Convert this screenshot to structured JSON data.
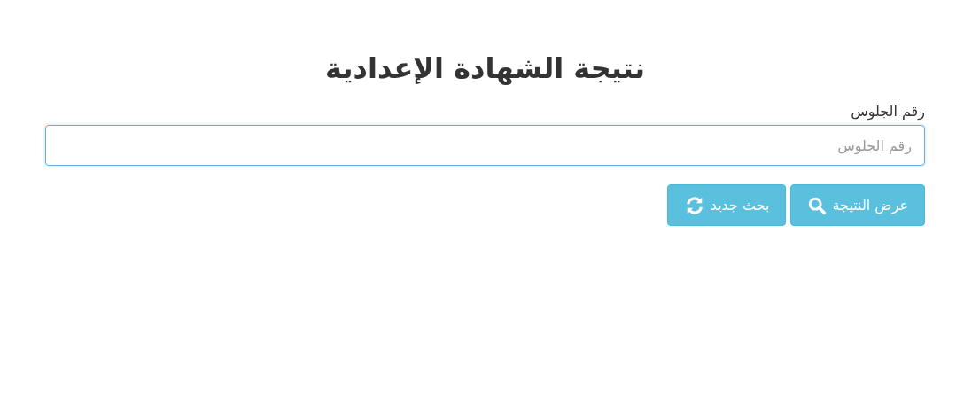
{
  "title": "نتيجة الشهادة الإعدادية",
  "form": {
    "label": "رقم الجلوس",
    "placeholder": "رقم الجلوس"
  },
  "buttons": [
    {
      "label": "عرض النتيجة",
      "kind": "search"
    },
    {
      "label": "بحث جديد",
      "kind": "refresh"
    }
  ]
}
